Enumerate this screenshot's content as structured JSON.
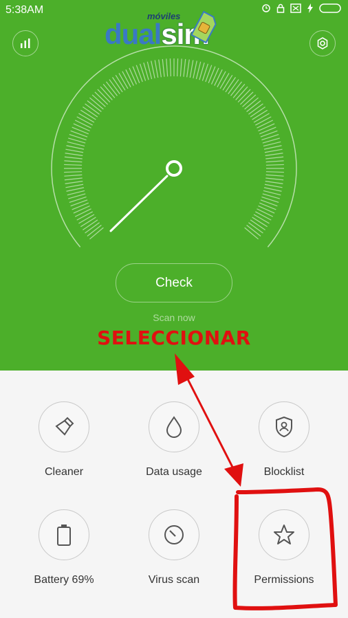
{
  "status_bar": {
    "time": "5:38AM"
  },
  "logo": {
    "small_text": "móviles",
    "part1": "dual",
    "part2": "sim"
  },
  "check_button": {
    "label": "Check"
  },
  "scan_hint": "Scan now",
  "annotation": {
    "text": "SELECCIONAR"
  },
  "tiles": [
    {
      "label": "Cleaner",
      "icon": "brush-icon"
    },
    {
      "label": "Data usage",
      "icon": "drop-icon"
    },
    {
      "label": "Blocklist",
      "icon": "shield-user-icon"
    },
    {
      "label": "Battery 69%",
      "icon": "battery-icon"
    },
    {
      "label": "Virus scan",
      "icon": "virus-scan-icon"
    },
    {
      "label": "Permissions",
      "icon": "star-icon"
    }
  ],
  "colors": {
    "header_green": "#4caf2a",
    "annotation_red": "#e01010"
  }
}
